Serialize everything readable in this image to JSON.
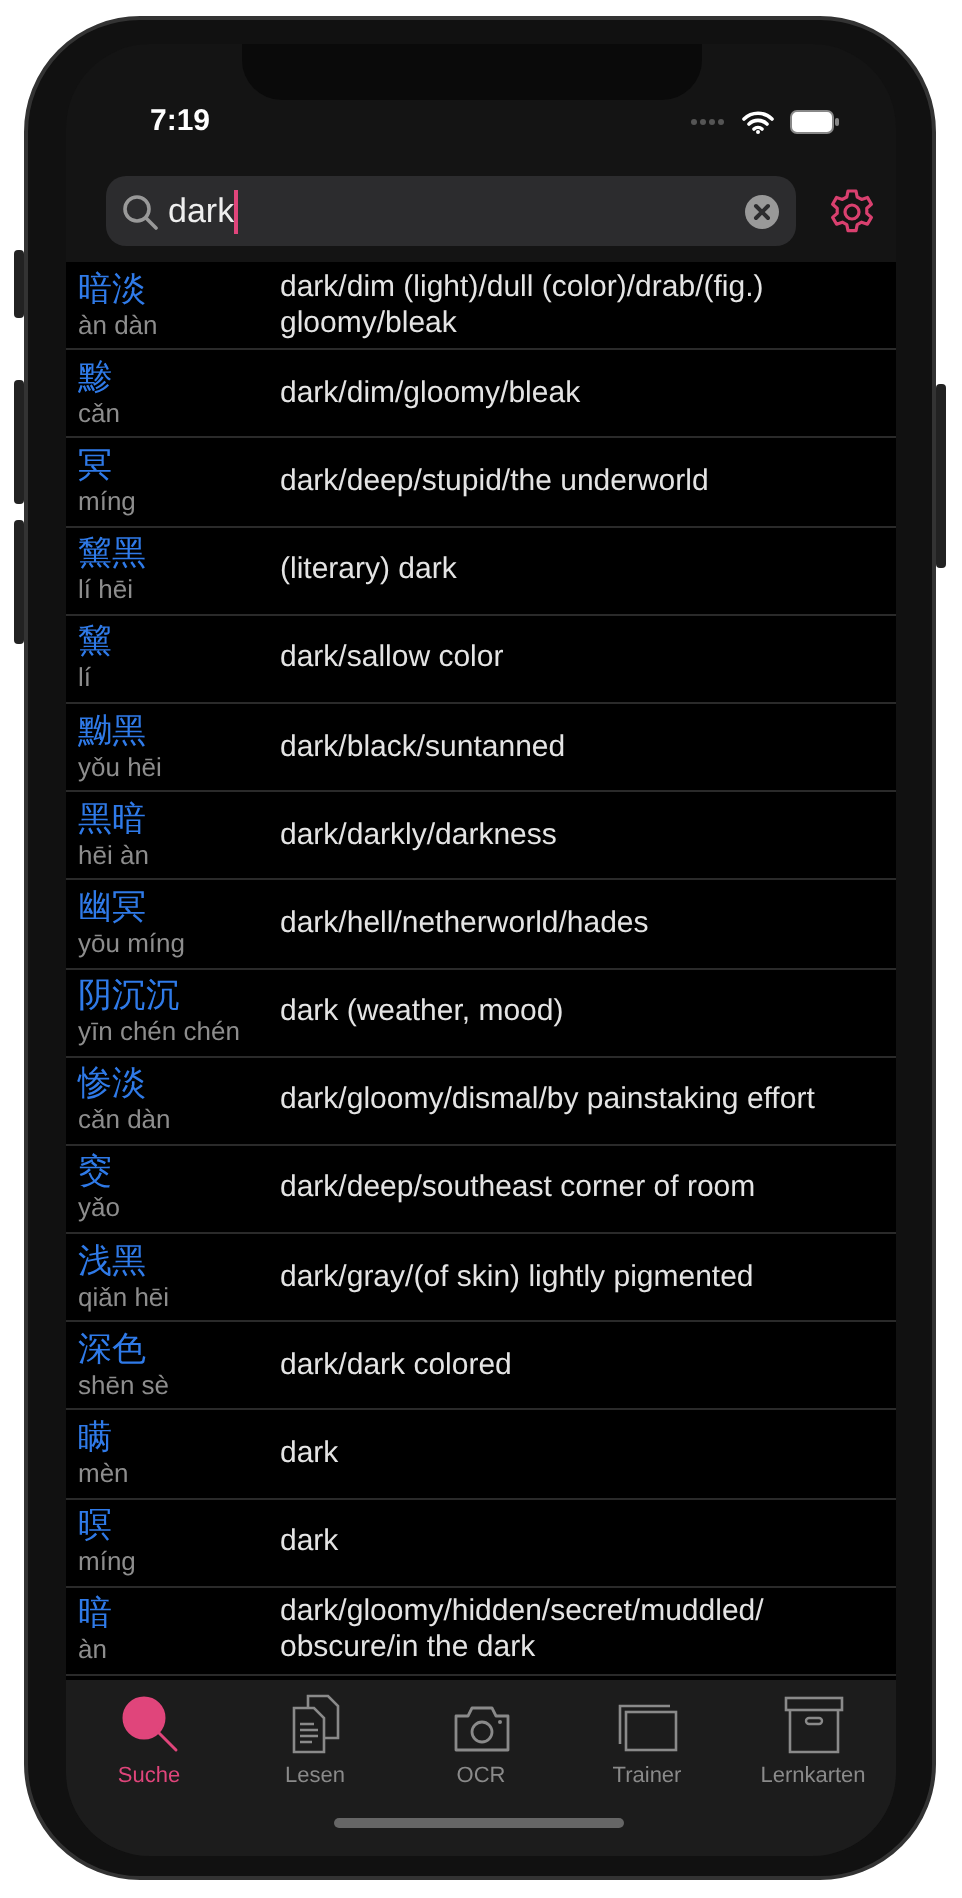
{
  "status_bar": {
    "time": "7:19"
  },
  "search": {
    "value": "dark"
  },
  "entries": [
    {
      "hanzi": "暗淡",
      "pinyin": "àn dàn",
      "definition": "dark/dim (light)/dull (color)/drab/(fig.) gloomy/bleak"
    },
    {
      "hanzi": "黪",
      "pinyin": "cǎn",
      "definition": "dark/dim/gloomy/bleak"
    },
    {
      "hanzi": "冥",
      "pinyin": "míng",
      "definition": "dark/deep/stupid/the underworld"
    },
    {
      "hanzi": "黧黑",
      "pinyin": "lí hēi",
      "definition": "(literary) dark"
    },
    {
      "hanzi": "黧",
      "pinyin": "lí",
      "definition": "dark/sallow color"
    },
    {
      "hanzi": "黝黑",
      "pinyin": "yǒu hēi",
      "definition": "dark/black/suntanned"
    },
    {
      "hanzi": "黑暗",
      "pinyin": "hēi àn",
      "definition": "dark/darkly/darkness"
    },
    {
      "hanzi": "幽冥",
      "pinyin": "yōu míng",
      "definition": "dark/hell/netherworld/hades"
    },
    {
      "hanzi": "阴沉沉",
      "pinyin": "yīn chén chén",
      "definition": "dark (weather, mood)"
    },
    {
      "hanzi": "惨淡",
      "pinyin": "cǎn dàn",
      "definition": "dark/gloomy/dismal/by painstaking effort"
    },
    {
      "hanzi": "窔",
      "pinyin": "yǎo",
      "definition": "dark/deep/southeast corner of room"
    },
    {
      "hanzi": "浅黑",
      "pinyin": "qiǎn hēi",
      "definition": "dark/gray/(of skin) lightly pigmented"
    },
    {
      "hanzi": "深色",
      "pinyin": "shēn sè",
      "definition": "dark/dark colored"
    },
    {
      "hanzi": "瞒",
      "pinyin": "mèn",
      "definition": "dark"
    },
    {
      "hanzi": "暝",
      "pinyin": "míng",
      "definition": "dark"
    },
    {
      "hanzi": "暗",
      "pinyin": "àn",
      "definition": "dark/gloomy/hidden/secret/muddled/ obscure/in the dark"
    }
  ],
  "tabs": [
    {
      "label": "Suche",
      "selected": true
    },
    {
      "label": "Lesen",
      "selected": false
    },
    {
      "label": "OCR",
      "selected": false
    },
    {
      "label": "Trainer",
      "selected": false
    },
    {
      "label": "Lernkarten",
      "selected": false
    }
  ]
}
